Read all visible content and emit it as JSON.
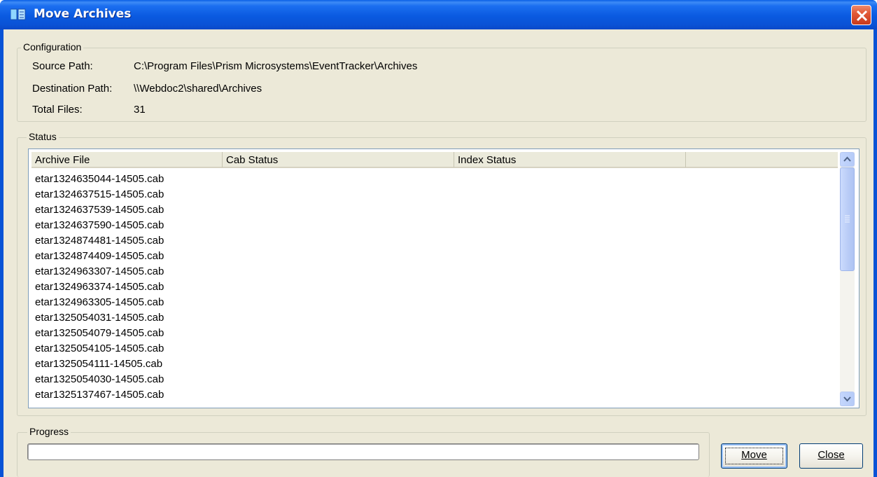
{
  "window": {
    "title": "Move Archives"
  },
  "configuration": {
    "group_label": "Configuration",
    "source_label": "Source Path:",
    "source_value": "C:\\Program Files\\Prism Microsystems\\EventTracker\\Archives",
    "destination_label": "Destination Path:",
    "destination_value": "\\\\Webdoc2\\shared\\Archives",
    "total_label": "Total Files:",
    "total_value": "31"
  },
  "status": {
    "group_label": "Status",
    "columns": [
      "Archive File",
      "Cab Status",
      "Index Status"
    ],
    "rows": [
      "etar1324635044-14505.cab",
      "etar1324637515-14505.cab",
      "etar1324637539-14505.cab",
      "etar1324637590-14505.cab",
      "etar1324874481-14505.cab",
      "etar1324874409-14505.cab",
      "etar1324963307-14505.cab",
      "etar1324963374-14505.cab",
      "etar1324963305-14505.cab",
      "etar1325054031-14505.cab",
      "etar1325054079-14505.cab",
      "etar1325054105-14505.cab",
      "etar1325054111-14505.cab",
      "etar1325054030-14505.cab",
      "etar1325137467-14505.cab"
    ]
  },
  "progress": {
    "group_label": "Progress",
    "value": 0
  },
  "buttons": {
    "move": "Move",
    "close": "Close"
  },
  "icons": {
    "window_icon": "archive-app-icon",
    "close": "close-icon",
    "scroll_up": "scroll-up-arrow-icon",
    "scroll_down": "scroll-down-arrow-icon",
    "scroll_grip": "scroll-grip-icon"
  },
  "colors": {
    "titlebar": "#0a5ae0",
    "client_bg": "#ece9d8",
    "close_button": "#e25a37"
  }
}
